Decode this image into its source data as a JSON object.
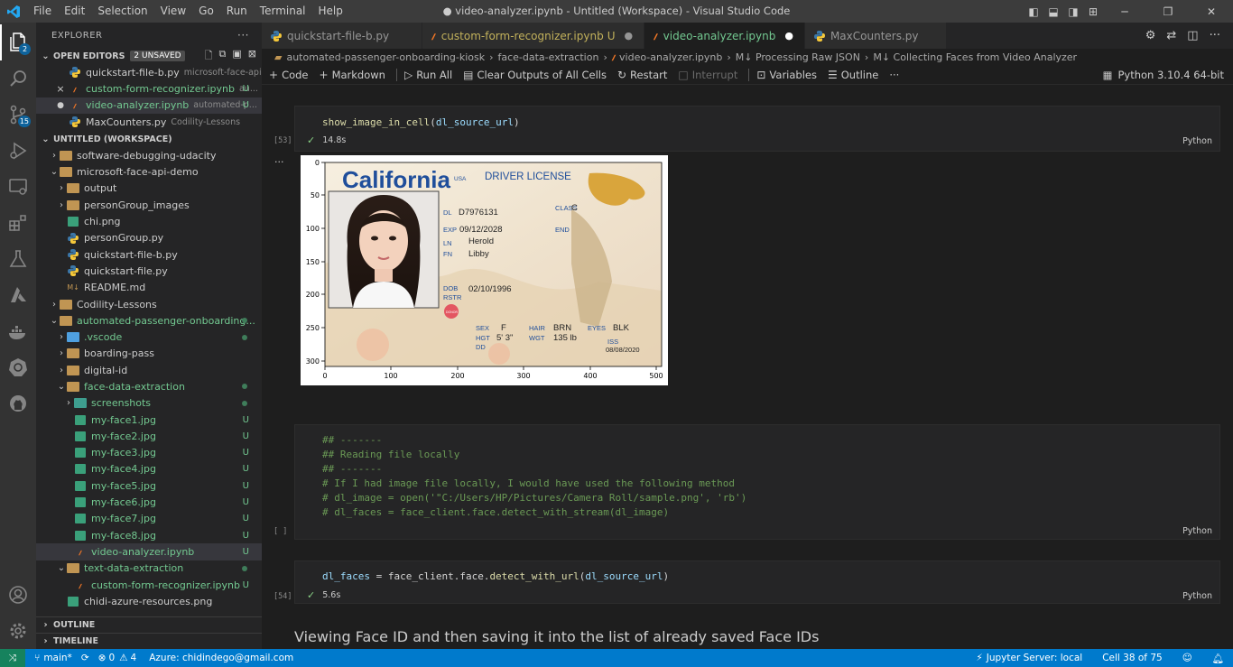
{
  "titlebar": {
    "menu": [
      "File",
      "Edit",
      "Selection",
      "View",
      "Go",
      "Run",
      "Terminal",
      "Help"
    ],
    "window_title": "● video-analyzer.ipynb - Untitled (Workspace) - Visual Studio Code"
  },
  "activity": {
    "explorer_badge": "2",
    "scm_badge": "15"
  },
  "sidebar": {
    "header": "EXPLORER",
    "open_editors": {
      "title": "OPEN EDITORS",
      "unsaved": "2 UNSAVED",
      "items": [
        {
          "name": "quickstart-file-b.py",
          "desc": "microsoft-face-api-de..."
        },
        {
          "name": "custom-form-recognizer.ipynb",
          "desc": "au...",
          "flag": "U",
          "marker": "×"
        },
        {
          "name": "video-analyzer.ipynb",
          "desc": "automated-p...",
          "flag": "U",
          "marker": "●"
        },
        {
          "name": "MaxCounters.py",
          "desc": "Codility-Lessons"
        }
      ]
    },
    "workspace": {
      "title": "UNTITLED (WORKSPACE)",
      "items": [
        {
          "label": "software-debugging-udacity"
        },
        {
          "label": "microsoft-face-api-demo"
        },
        {
          "label": "output"
        },
        {
          "label": "personGroup_images"
        },
        {
          "label": "chi.png"
        },
        {
          "label": "personGroup.py"
        },
        {
          "label": "quickstart-file-b.py"
        },
        {
          "label": "quickstart-file.py"
        },
        {
          "label": "README.md"
        },
        {
          "label": "Codility-Lessons"
        },
        {
          "label": "automated-passenger-onboarding..."
        },
        {
          "label": ".vscode"
        },
        {
          "label": "boarding-pass"
        },
        {
          "label": "digital-id"
        },
        {
          "label": "face-data-extraction"
        },
        {
          "label": "screenshots"
        },
        {
          "label": "my-face1.jpg",
          "flag": "U"
        },
        {
          "label": "my-face2.jpg",
          "flag": "U"
        },
        {
          "label": "my-face3.jpg",
          "flag": "U"
        },
        {
          "label": "my-face4.jpg",
          "flag": "U"
        },
        {
          "label": "my-face5.jpg",
          "flag": "U"
        },
        {
          "label": "my-face6.jpg",
          "flag": "U"
        },
        {
          "label": "my-face7.jpg",
          "flag": "U"
        },
        {
          "label": "my-face8.jpg",
          "flag": "U"
        },
        {
          "label": "video-analyzer.ipynb",
          "flag": "U"
        },
        {
          "label": "text-data-extraction"
        },
        {
          "label": "custom-form-recognizer.ipynb",
          "flag": "U"
        },
        {
          "label": "chidi-azure-resources.png"
        }
      ]
    },
    "outline": "OUTLINE",
    "timeline": "TIMELINE"
  },
  "tabs": [
    {
      "label": "quickstart-file-b.py"
    },
    {
      "label": "custom-form-recognizer.ipynb",
      "flag": "U",
      "mark": "●"
    },
    {
      "label": "video-analyzer.ipynb",
      "mark": "●"
    },
    {
      "label": "MaxCounters.py"
    }
  ],
  "breadcrumb": [
    "automated-passenger-onboarding-kiosk",
    "face-data-extraction",
    "video-analyzer.ipynb",
    "M↓ Processing Raw JSON",
    "M↓ Collecting Faces from Video Analyzer"
  ],
  "toolbar": {
    "code": "Code",
    "markdown": "Markdown",
    "run_all": "Run All",
    "clear": "Clear Outputs of All Cells",
    "restart": "Restart",
    "interrupt": "Interrupt",
    "variables": "Variables",
    "outline": "Outline",
    "more": "···",
    "kernel": "Python 3.10.4 64-bit"
  },
  "cells": {
    "c1": {
      "fn": "show_image_in_cell",
      "arg": "dl_source_url",
      "exec": "[53]",
      "time": "14.8s",
      "lang": "Python"
    },
    "c2": {
      "lines": [
        "## -------",
        "## Reading file locally",
        "## -------",
        "# If I had image file locally, I would have used the following method",
        "# dl_image = open('\"C:/Users/HP/Pictures/Camera Roll/sample.png', 'rb')",
        "# dl_faces = face_client.face.detect_with_stream(dl_image)"
      ],
      "exec": "[ ]",
      "lang": "Python"
    },
    "c3": {
      "var": "dl_faces",
      "eq": " = face_client.face.",
      "fn": "detect_with_url",
      "arg": "dl_source_url",
      "exec": "[54]",
      "time": "5.6s",
      "lang": "Python"
    },
    "out_dots": "···",
    "heading": "Viewing Face ID and then saving it into the list of already saved Face IDs"
  },
  "figure": {
    "card": {
      "state": "California",
      "usa": "USA",
      "type": "DRIVER LICENSE",
      "dl_label": "DL",
      "dl": "D7976131",
      "class_label": "CLASS",
      "class": "C",
      "exp_label": "EXP",
      "exp": "09/12/2028",
      "end_label": "END",
      "ln_label": "LN",
      "ln": "Herold",
      "fn_label": "FN",
      "fn": "Libby",
      "dob_label": "DOB",
      "dob": "02/10/1996",
      "rstr_label": "RSTR",
      "donor": "DONOR",
      "sex_label": "SEX",
      "sex": "F",
      "hair_label": "HAIR",
      "hair": "BRN",
      "eyes_label": "EYES",
      "eyes": "BLK",
      "hgt_label": "HGT",
      "hgt": "5' 3\"",
      "wgt_label": "WGT",
      "wgt": "135 lb",
      "dd_label": "DD",
      "iss_label": "ISS",
      "iss": "08/08/2020"
    },
    "xticks": [
      "0",
      "100",
      "200",
      "300",
      "400",
      "500"
    ],
    "yticks": [
      "0",
      "50",
      "100",
      "150",
      "200",
      "250",
      "300"
    ]
  },
  "statusbar": {
    "branch": "main*",
    "errors": "0",
    "warnings": "4",
    "azure": "Azure: chidindego@gmail.com",
    "jupyter": "Jupyter Server: local",
    "cell": "Cell 38 of 75"
  },
  "colors": {
    "accent": "#007acc",
    "remote": "#16825d",
    "untracked": "#73c991"
  }
}
